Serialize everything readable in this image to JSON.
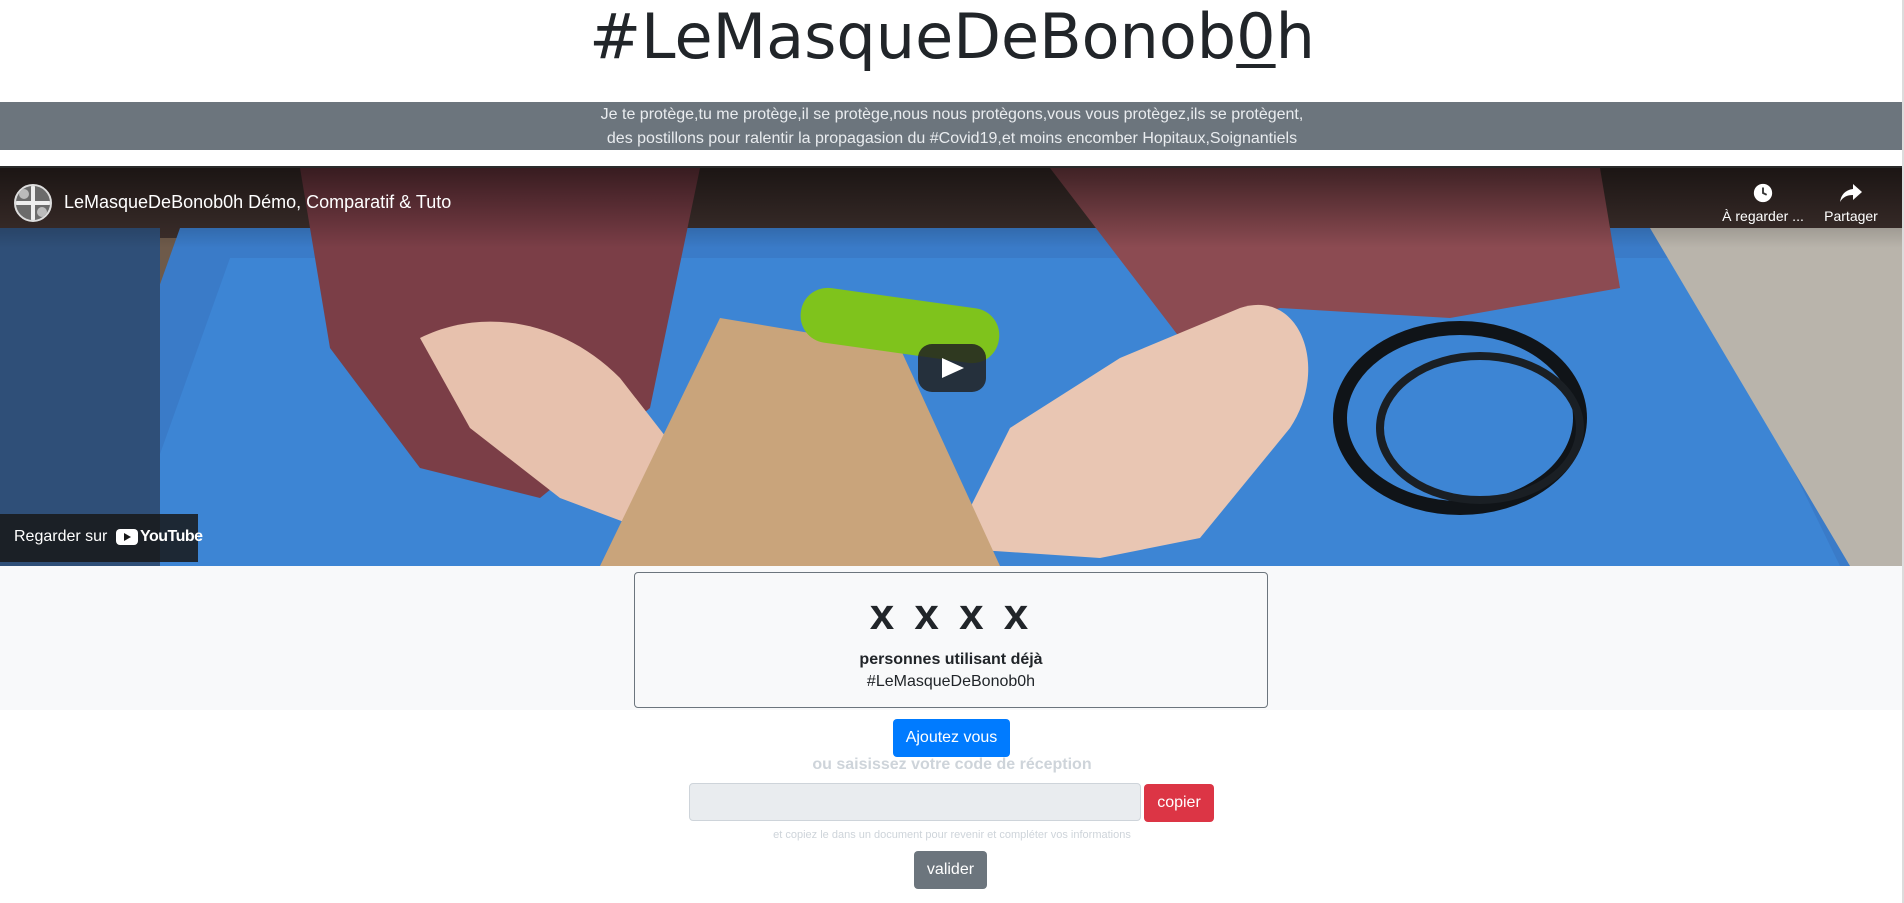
{
  "header": {
    "title_before": "#LeMasqueDeBonob",
    "title_underlined": "0",
    "title_after": "h"
  },
  "banner": {
    "line1": "Je te protège,tu me protège,il se protège,nous nous protègons,vous vous protègez,ils se protègent,",
    "line2": "des postillons pour ralentir la propagasion du #Covid19,et moins encomber Hopitaux,Soignantiels"
  },
  "video": {
    "title": "LeMasqueDeBonob0h Démo, Comparatif & Tuto",
    "watch_later_label": "À regarder ...",
    "share_label": "Partager",
    "watch_on_label": "Regarder sur",
    "youtube_word": "YouTube",
    "icons": {
      "watch_later": "clock-icon",
      "share": "share-arrow-icon",
      "play": "play-icon",
      "youtube": "youtube-logo-icon"
    }
  },
  "counter": {
    "value": "x x x x",
    "label": "personnes utilisant déjà",
    "tag": "#LeMasqueDeBonob0h"
  },
  "actions": {
    "add_label": "Ajoutez vous",
    "or_text": "ou saisissez votre code de réception",
    "code_value": "",
    "copy_label": "copier",
    "hint": "et copiez le dans un document pour revenir et compléter vos informations",
    "validate_label": "valider"
  },
  "colors": {
    "primary": "#007bff",
    "danger": "#dc3545",
    "secondary": "#6c757d",
    "light": "#f8f9fa"
  }
}
